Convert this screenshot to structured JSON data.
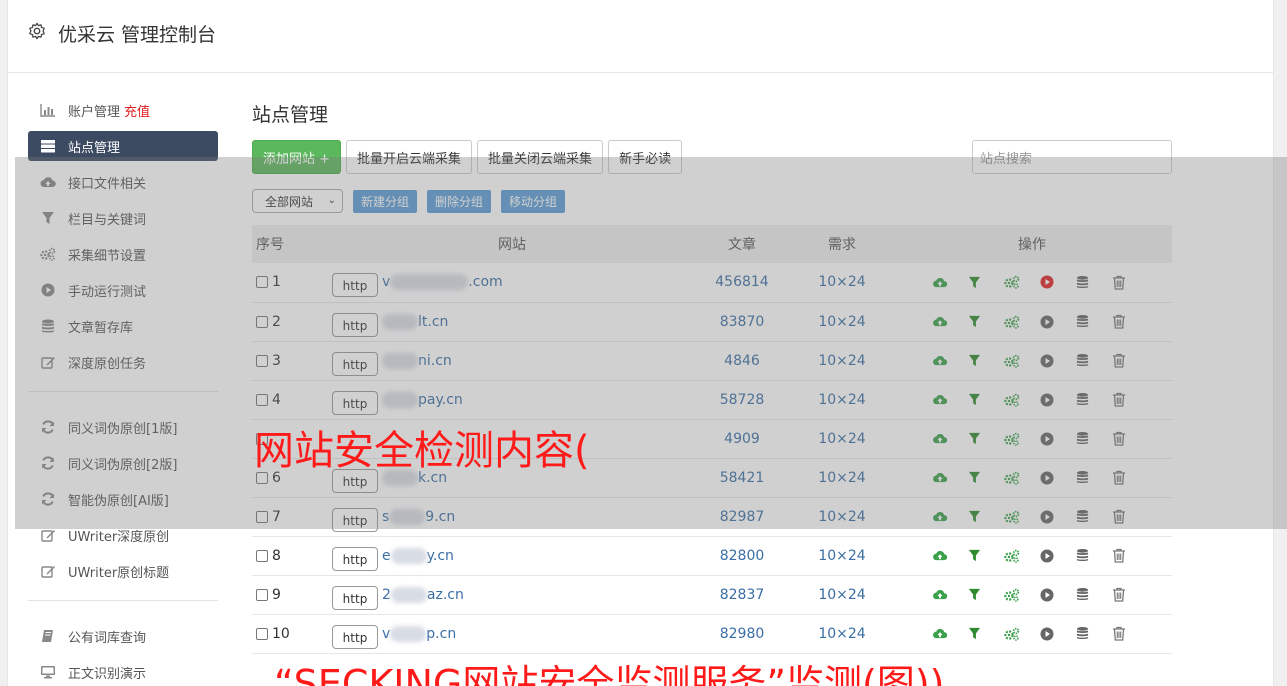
{
  "header": {
    "title": "优采云 管理控制台"
  },
  "sidebar": {
    "items": [
      {
        "label": "账户管理",
        "extra": "充值",
        "icon": "bar-chart-icon"
      },
      {
        "label": "站点管理",
        "icon": "server-icon",
        "active": true
      },
      {
        "label": "接口文件相关",
        "icon": "cloud-upload-icon"
      },
      {
        "label": "栏目与关键词",
        "icon": "filter-icon"
      },
      {
        "label": "采集细节设置",
        "icon": "cogs-icon"
      },
      {
        "label": "手动运行测试",
        "icon": "play-circle-icon"
      },
      {
        "label": "文章暂存库",
        "icon": "database-icon"
      },
      {
        "label": "深度原创任务",
        "icon": "edit-icon"
      }
    ],
    "items2": [
      {
        "label": "同义词伪原创[1版]",
        "icon": "refresh-icon"
      },
      {
        "label": "同义词伪原创[2版]",
        "icon": "refresh-icon"
      },
      {
        "label": "智能伪原创[AI版]",
        "icon": "refresh-icon"
      },
      {
        "label": "UWriter深度原创",
        "icon": "edit-icon"
      },
      {
        "label": "UWriter原创标题",
        "icon": "edit-icon"
      }
    ],
    "items3": [
      {
        "label": "公有词库查询",
        "icon": "book-icon"
      },
      {
        "label": "正文识别演示",
        "icon": "monitor-icon"
      }
    ]
  },
  "main": {
    "title": "站点管理",
    "toolbar": {
      "add_site": "添加网站 +",
      "batch_open": "批量开启云端采集",
      "batch_close": "批量关闭云端采集",
      "guide": "新手必读",
      "search_placeholder": "站点搜索"
    },
    "subbar": {
      "group_select": "全部网站",
      "new_group": "新建分组",
      "delete_group": "删除分组",
      "move_group": "移动分组"
    },
    "table": {
      "headers": [
        "序号",
        "网站",
        "文章",
        "需求",
        "操作"
      ],
      "rows": [
        {
          "idx": "1",
          "proto": "http",
          "domain_prefix": "v",
          "domain_suffix": ".com",
          "articles": "456814",
          "demand": "10×24",
          "running": true
        },
        {
          "idx": "2",
          "proto": "http",
          "domain_prefix": "",
          "domain_suffix": "lt.cn",
          "articles": "83870",
          "demand": "10×24",
          "running": false
        },
        {
          "idx": "3",
          "proto": "http",
          "domain_prefix": "",
          "domain_suffix": "ni.cn",
          "articles": "4846",
          "demand": "10×24",
          "running": false
        },
        {
          "idx": "4",
          "proto": "http",
          "domain_prefix": "",
          "domain_suffix": "pay.cn",
          "articles": "58728",
          "demand": "10×24",
          "running": false
        },
        {
          "idx": "",
          "proto": "",
          "domain_prefix": "",
          "domain_suffix": "",
          "articles": "4909",
          "demand": "10×24",
          "running": false
        },
        {
          "idx": "6",
          "proto": "http",
          "domain_prefix": "",
          "domain_suffix": "k.cn",
          "articles": "58421",
          "demand": "10×24",
          "running": false
        },
        {
          "idx": "7",
          "proto": "http",
          "domain_prefix": "s",
          "domain_suffix": "9.cn",
          "articles": "82987",
          "demand": "10×24",
          "running": false
        },
        {
          "idx": "8",
          "proto": "http",
          "domain_prefix": "e",
          "domain_suffix": "y.cn",
          "articles": "82800",
          "demand": "10×24",
          "running": false
        },
        {
          "idx": "9",
          "proto": "http",
          "domain_prefix": "2",
          "domain_suffix": "az.cn",
          "articles": "82837",
          "demand": "10×24",
          "running": false
        },
        {
          "idx": "10",
          "proto": "http",
          "domain_prefix": "v",
          "domain_suffix": "p.cn",
          "articles": "82980",
          "demand": "10×24",
          "running": false
        }
      ]
    }
  },
  "watermarks": {
    "middle": "网站安全检测内容(",
    "bottom": "“SECKING网站安全监测服务”监测(图))"
  },
  "colors": {
    "green": "#3aa04a",
    "red": "#e02020",
    "blue": "#3a6ea5",
    "sidebar_active": "#3c4a62"
  }
}
